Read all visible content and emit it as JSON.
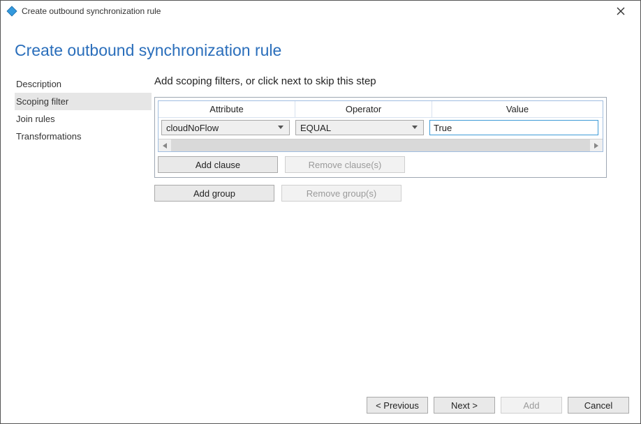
{
  "titlebar": {
    "title": "Create outbound synchronization rule"
  },
  "page_title": "Create outbound synchronization rule",
  "sidebar": {
    "items": [
      {
        "label": "Description",
        "selected": false
      },
      {
        "label": "Scoping filter",
        "selected": true
      },
      {
        "label": "Join rules",
        "selected": false
      },
      {
        "label": "Transformations",
        "selected": false
      }
    ]
  },
  "content": {
    "instruction": "Add scoping filters, or click next to skip this step",
    "columns": {
      "attribute": "Attribute",
      "operator": "Operator",
      "value": "Value"
    },
    "row": {
      "attribute": "cloudNoFlow",
      "operator": "EQUAL",
      "value": "True"
    },
    "buttons": {
      "add_clause": "Add clause",
      "remove_clause": "Remove clause(s)",
      "add_group": "Add group",
      "remove_group": "Remove group(s)"
    }
  },
  "footer": {
    "previous": "< Previous",
    "next": "Next >",
    "add": "Add",
    "cancel": "Cancel"
  }
}
